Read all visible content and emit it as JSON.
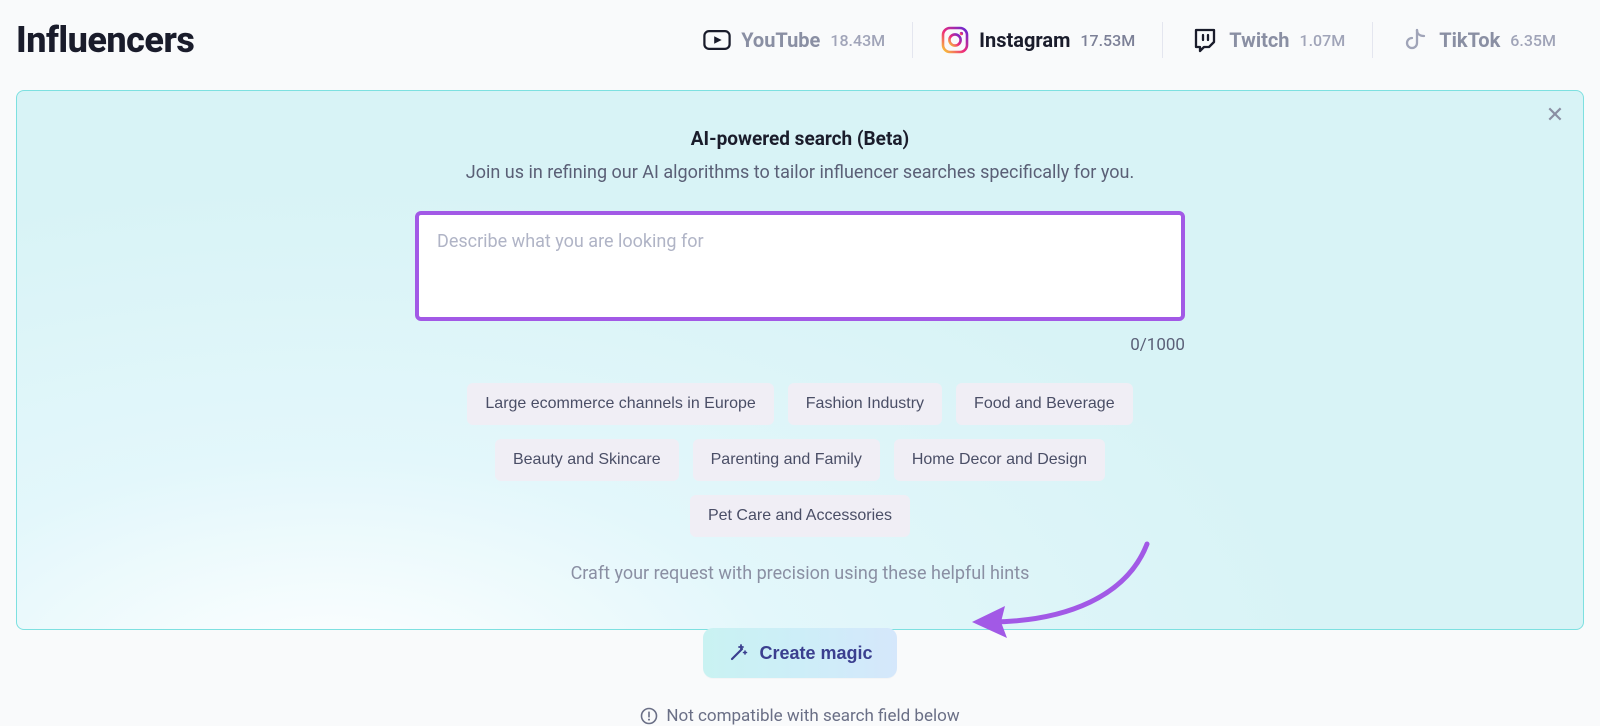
{
  "header": {
    "title": "Influencers"
  },
  "tabs": [
    {
      "name": "youtube",
      "label": "YouTube",
      "count": "18.43M",
      "active": false
    },
    {
      "name": "instagram",
      "label": "Instagram",
      "count": "17.53M",
      "active": true
    },
    {
      "name": "twitch",
      "label": "Twitch",
      "count": "1.07M",
      "active": false
    },
    {
      "name": "tiktok",
      "label": "TikTok",
      "count": "6.35M",
      "active": false
    }
  ],
  "ai_search": {
    "title": "AI-powered search (Beta)",
    "subtitle": "Join us in refining our AI algorithms to tailor influencer searches specifically for you.",
    "textarea_placeholder": "Describe what you are looking for",
    "textarea_value": "",
    "counter": "0/1000",
    "chips": [
      "Large ecommerce channels in Europe",
      "Fashion Industry",
      "Food and Beverage",
      "Beauty and Skincare",
      "Parenting and Family",
      "Home Decor and Design",
      "Pet Care and Accessories"
    ],
    "hint": "Craft your request with precision using these helpful hints",
    "cta": "Create magic",
    "compat_note": "Not compatible with search field below"
  },
  "annotation": {
    "arrow_color": "#a259e6"
  },
  "colors": {
    "accent_purple": "#a259e6",
    "card_border": "#7de0e0"
  }
}
